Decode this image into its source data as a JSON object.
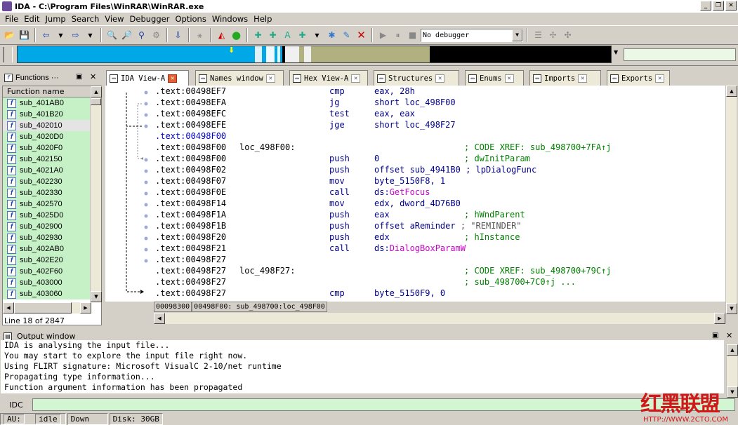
{
  "titlebar": {
    "title": "IDA - C:\\Program Files\\WinRAR\\WinRAR.exe"
  },
  "menu": [
    "File",
    "Edit",
    "Jump",
    "Search",
    "View",
    "Debugger",
    "Options",
    "Windows",
    "Help"
  ],
  "toolbar": {
    "debugger_select": "No debugger"
  },
  "tabs": [
    {
      "label": "IDA View-A",
      "icon": "disasm-icon",
      "active": true
    },
    {
      "label": "Names window",
      "icon": "names-icon"
    },
    {
      "label": "Hex View-A",
      "icon": "hex-icon"
    },
    {
      "label": "Structures",
      "icon": "struct-icon"
    },
    {
      "label": "Enums",
      "icon": "enum-icon"
    },
    {
      "label": "Imports",
      "icon": "imports-icon"
    },
    {
      "label": "Exports",
      "icon": "exports-icon"
    }
  ],
  "functions": {
    "title": "Functions ···",
    "column": "Function name",
    "items": [
      "sub_401AB0",
      "sub_401B20",
      "sub_402010",
      "sub_4020D0",
      "sub_4020F0",
      "sub_402150",
      "sub_4021A0",
      "sub_402230",
      "sub_402330",
      "sub_402570",
      "sub_4025D0",
      "sub_402900",
      "sub_402930",
      "sub_402AB0",
      "sub_402E20",
      "sub_402F60",
      "sub_403000",
      "sub_403060"
    ],
    "selected_index": 2,
    "status": "Line 18 of 2847"
  },
  "code": [
    {
      "addr": ".text:00498EF7",
      "mn": "cmp",
      "op": "eax, 28h"
    },
    {
      "addr": ".text:00498EFA",
      "mn": "jg",
      "op": "short loc_498F00"
    },
    {
      "addr": ".text:00498EFC",
      "mn": "test",
      "op": "eax, eax"
    },
    {
      "addr": ".text:00498EFE",
      "mn": "jge",
      "op": "short loc_498F27"
    },
    {
      "addr": ".text:00498F00",
      "addrblue": true
    },
    {
      "addr": ".text:00498F00",
      "lbl": "loc_498F00:",
      "cm": "; CODE XREF: sub_498700+7FA↑j"
    },
    {
      "addr": ".text:00498F00",
      "mn": "push",
      "op": "0",
      "cm": "; dwInitParam"
    },
    {
      "addr": ".text:00498F02",
      "mn": "push",
      "op": "offset sub_4941B0",
      "cm2": "; lpDialogFunc"
    },
    {
      "addr": ".text:00498F07",
      "mn": "mov",
      "op": "byte_5150F8, 1"
    },
    {
      "addr": ".text:00498F0E",
      "mn": "call",
      "op": "ds:",
      "pink": "GetFocus"
    },
    {
      "addr": ".text:00498F14",
      "mn": "mov",
      "op": "edx, dword_4D76B0"
    },
    {
      "addr": ".text:00498F1A",
      "mn": "push",
      "op": "eax",
      "cm": "; hWndParent"
    },
    {
      "addr": ".text:00498F1B",
      "mn": "push",
      "op": "offset aReminder",
      "grey": "; \"REMINDER\""
    },
    {
      "addr": ".text:00498F20",
      "mn": "push",
      "op": "edx",
      "cm": "; hInstance"
    },
    {
      "addr": ".text:00498F21",
      "mn": "call",
      "op": "ds:",
      "pink": "DialogBoxParamW"
    },
    {
      "addr": ".text:00498F27"
    },
    {
      "addr": ".text:00498F27",
      "lbl": "loc_498F27:",
      "cm": "; CODE XREF: sub_498700+79C↑j"
    },
    {
      "addr": ".text:00498F27",
      "cm": "; sub_498700+7C0↑j ..."
    },
    {
      "addr": ".text:00498F27",
      "mn": "cmp",
      "op": "byte_5150F9, 0"
    }
  ],
  "code_status": {
    "offset": "00098300",
    "location": "00498F00: sub_498700:loc_498F00"
  },
  "output": {
    "title": "Output window",
    "lines": [
      "IDA is analysing the input file...",
      "You may start to explore the input file right now.",
      "Using FLIRT signature: Microsoft VisualC 2-10/net runtime",
      "Propagating type information...",
      "Function argument information has been propagated"
    ]
  },
  "idc": {
    "label": "IDC"
  },
  "statusbar": {
    "au": "AU:",
    "state": "idle",
    "direction": "Down",
    "disk": "Disk: 30GB"
  },
  "watermark": {
    "text": "红黑联盟",
    "url": "HTTP://WWW.2CTO.COM"
  }
}
